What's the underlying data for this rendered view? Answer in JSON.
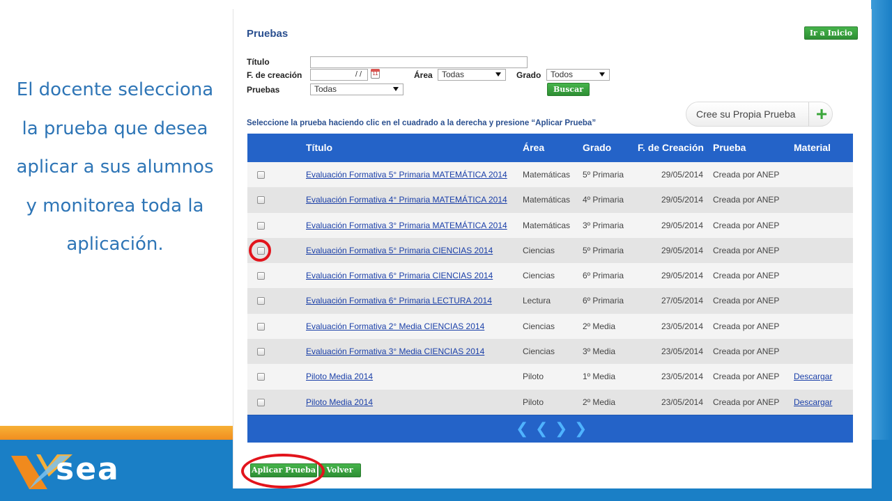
{
  "slide": {
    "caption_lines": [
      "El docente selecciona",
      "la prueba que desea",
      "aplicar a sus alumnos",
      "y monitorea toda la",
      "aplicación."
    ],
    "logo_text": "sea",
    "colors": {
      "blue": "#1a7fc6",
      "orange": "#f39c1f",
      "caption": "#2e75b6",
      "highlight": "#e2141c"
    }
  },
  "app": {
    "title": "Pruebas",
    "home_button": "Ir a Inicio",
    "filters": {
      "title_label": "Título",
      "title_value": "",
      "date_label": "F. de creación",
      "date_value": "/ /",
      "calendar_day": "11",
      "area_label": "Área",
      "area_value": "Todas",
      "grade_label": "Grado",
      "grade_value": "Todos",
      "tests_label": "Pruebas",
      "tests_value": "Todas",
      "search_button": "Buscar"
    },
    "instruction": "Seleccione la prueba haciendo clic en el cuadrado a la derecha y presione “Aplicar Prueba”",
    "create_button": "Cree su Propia Prueba",
    "create_plus": "+",
    "table": {
      "headers": [
        "Título",
        "Área",
        "Grado",
        "F. de Creación",
        "Prueba",
        "Material"
      ],
      "rows": [
        {
          "title": "Evaluación Formativa 5° Primaria MATEMÁTICA 2014",
          "area": "Matemáticas",
          "grade": "5º Primaria",
          "date": "29/05/2014",
          "test": "Creada por ANEP",
          "material": ""
        },
        {
          "title": "Evaluación Formativa 4° Primaria MATEMÁTICA 2014",
          "area": "Matemáticas",
          "grade": "4º Primaria",
          "date": "29/05/2014",
          "test": "Creada por ANEP",
          "material": ""
        },
        {
          "title": "Evaluación Formativa 3° Primaria MATEMÁTICA 2014",
          "area": "Matemáticas",
          "grade": "3º Primaria",
          "date": "29/05/2014",
          "test": "Creada por ANEP",
          "material": ""
        },
        {
          "title": "Evaluación Formativa 5° Primaria CIENCIAS 2014",
          "area": "Ciencias",
          "grade": "5º Primaria",
          "date": "29/05/2014",
          "test": "Creada por ANEP",
          "material": ""
        },
        {
          "title": "Evaluación Formativa 6° Primaria CIENCIAS 2014",
          "area": "Ciencias",
          "grade": "6º Primaria",
          "date": "29/05/2014",
          "test": "Creada por ANEP",
          "material": ""
        },
        {
          "title": "Evaluación Formativa 6° Primaria LECTURA 2014",
          "area": "Lectura",
          "grade": "6º Primaria",
          "date": "27/05/2014",
          "test": "Creada por ANEP",
          "material": ""
        },
        {
          "title": "Evaluación Formativa 2° Media CIENCIAS 2014",
          "area": "Ciencias",
          "grade": "2º Media",
          "date": "23/05/2014",
          "test": "Creada por ANEP",
          "material": ""
        },
        {
          "title": "Evaluación Formativa 3° Media CIENCIAS 2014",
          "area": "Ciencias",
          "grade": "3º Media",
          "date": "23/05/2014",
          "test": "Creada por ANEP",
          "material": ""
        },
        {
          "title": "Piloto Media 2014",
          "area": "Piloto",
          "grade": "1º Media",
          "date": "23/05/2014",
          "test": "Creada por ANEP",
          "material": "Descargar"
        },
        {
          "title": "Piloto Media 2014",
          "area": "Piloto",
          "grade": "2º Media",
          "date": "23/05/2014",
          "test": "Creada por ANEP",
          "material": "Descargar"
        }
      ]
    },
    "pager": {
      "first": "❮",
      "prev": "❮",
      "next": "❯",
      "last": "❯"
    },
    "apply_button": "Aplicar Prueba",
    "back_button": "Volver"
  }
}
